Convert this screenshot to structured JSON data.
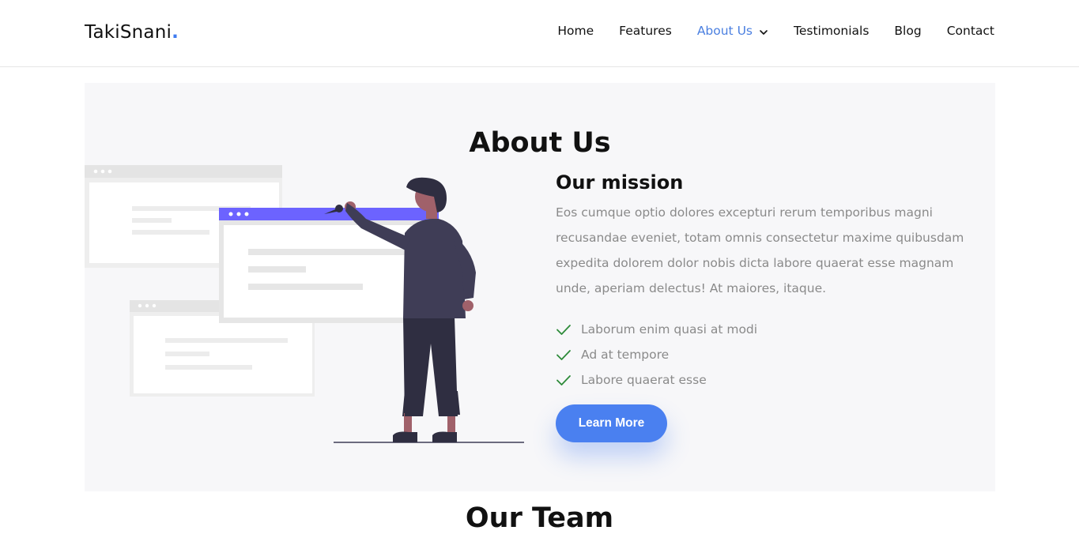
{
  "header": {
    "logo_text": "TakiSnani",
    "logo_dot": ".",
    "nav": [
      {
        "label": "Home"
      },
      {
        "label": "Features"
      },
      {
        "label": "About Us",
        "active": true
      },
      {
        "label": "Testimonials"
      },
      {
        "label": "Blog"
      },
      {
        "label": "Contact"
      }
    ]
  },
  "about": {
    "title": "About Us",
    "mission_title": "Our mission",
    "mission_text": "Eos cumque optio dolores excepturi rerum temporibus magni recusandae eveniet, totam omnis consectetur maxime quibusdam expedita dolorem dolor nobis dicta labore quaerat esse magnam unde, aperiam delectus! At maiores, itaque.",
    "checklist": [
      "Laborum enim quasi at modi",
      "Ad at tempore",
      "Labore quaerat esse"
    ],
    "button_label": "Learn More"
  },
  "team": {
    "title": "Our Team"
  },
  "colors": {
    "accent": "#4a80f0",
    "check": "#2e8b3a",
    "illustration_purple": "#6c63ff",
    "illustration_dark": "#3f3d56"
  }
}
